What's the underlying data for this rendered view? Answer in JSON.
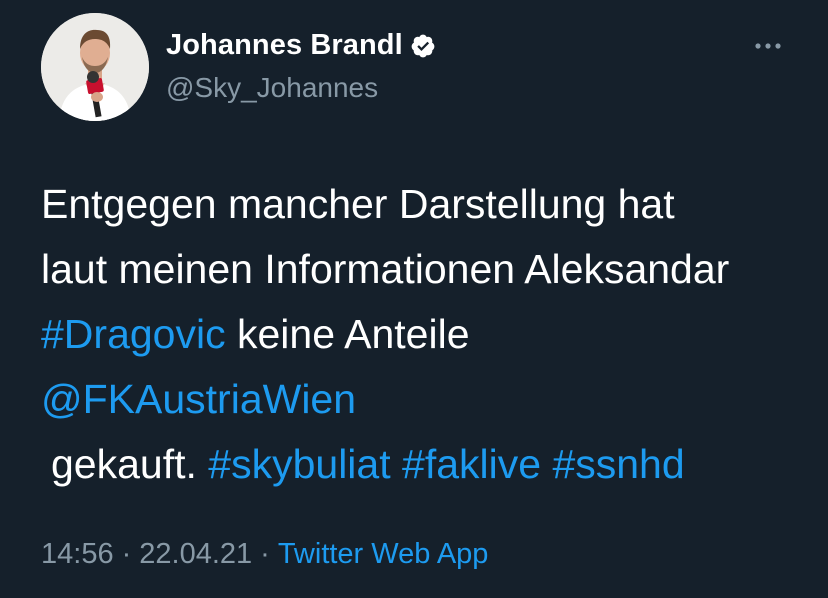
{
  "author": {
    "display_name": "Johannes Brandl",
    "handle": "@Sky_Johannes",
    "verified": true
  },
  "tweet": {
    "line1": "Entgegen mancher Darstellung hat",
    "line2": "laut meinen Informationen Aleksandar",
    "line3_hashtag": "#Dragovic",
    "line3_text": " keine Anteile",
    "line4_mention": "@FKAustriaWien",
    "line5_text": "gekauft. ",
    "hashtags_end": [
      "#skybuliat",
      "#faklive",
      "#ssnhd"
    ]
  },
  "meta": {
    "time": "14:56",
    "separator": "·",
    "date": "22.04.21",
    "source": "Twitter Web App"
  },
  "icons": {
    "verified": "verified-badge-icon",
    "more": "more-horizontal-icon"
  },
  "colors": {
    "background": "#15202b",
    "text": "#ffffff",
    "secondary": "#8899a6",
    "link": "#1d9bf0"
  }
}
